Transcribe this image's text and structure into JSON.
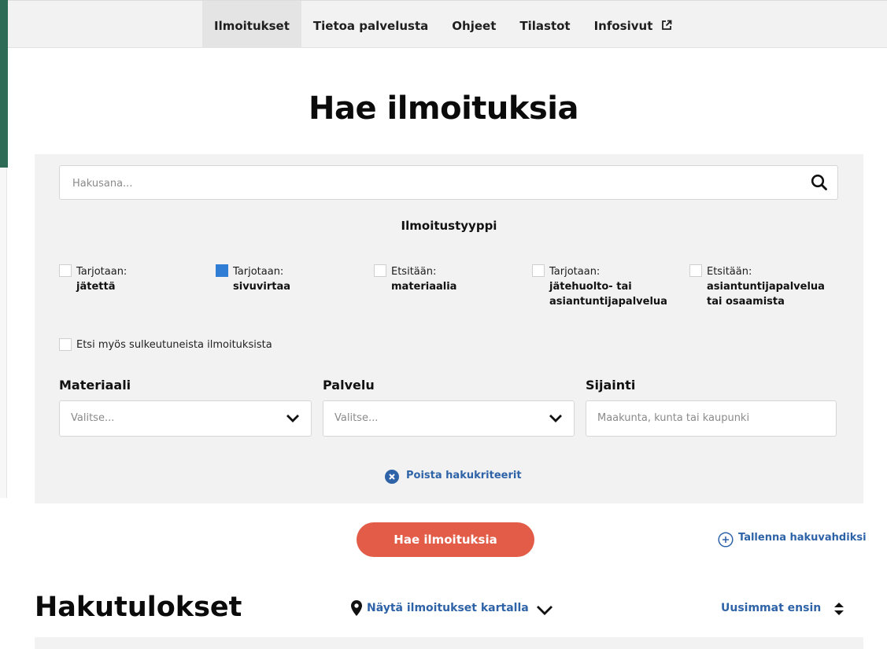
{
  "nav": {
    "items": [
      {
        "label": "Ilmoitukset",
        "active": true
      },
      {
        "label": "Tietoa palvelusta",
        "active": false
      },
      {
        "label": "Ohjeet",
        "active": false
      },
      {
        "label": "Tilastot",
        "active": false
      },
      {
        "label": "Infosivut",
        "active": false,
        "icon": "external-link-icon"
      }
    ]
  },
  "page": {
    "title": "Hae ilmoituksia"
  },
  "search": {
    "placeholder": "Hakusana...",
    "value": "",
    "icon": "search-icon"
  },
  "types": {
    "heading": "Ilmoitustyyppi",
    "options": [
      {
        "line1": "Tarjotaan:",
        "line2": "jätettä",
        "checked": false
      },
      {
        "line1": "Tarjotaan:",
        "line2": "sivuvirtaa",
        "checked": true
      },
      {
        "line1": "Etsitään:",
        "line2": "materiaalia",
        "checked": false
      },
      {
        "line1": "Tarjotaan:",
        "line2": "jätehuolto- tai asiantuntijapalvelua",
        "checked": false
      },
      {
        "line1": "Etsitään:",
        "line2": "asiantuntijapalvelua tai osaamista",
        "checked": false
      }
    ]
  },
  "closed": {
    "label": "Etsi myös sulkeutuneista ilmoituksista",
    "checked": false
  },
  "filters": {
    "material": {
      "label": "Materiaali",
      "placeholder": "Valitse..."
    },
    "service": {
      "label": "Palvelu",
      "placeholder": "Valitse..."
    },
    "location": {
      "label": "Sijainti",
      "placeholder": "Maakunta, kunta tai kaupunki"
    }
  },
  "clear_criteria": "Poista hakukriteerit",
  "search_button": "Hae ilmoituksia",
  "save_watch": "Tallenna hakuvahdiksi",
  "results": {
    "title": "Hakutulokset",
    "map_toggle": "Näytä ilmoitukset kartalla",
    "sort": "Uusimmat ensin"
  },
  "colors": {
    "accent_green": "#2e6b57",
    "primary_button": "#e25c48",
    "link_blue": "#2f63a8",
    "checkbox_blue": "#2f7dd4",
    "panel_bg": "#f2f2f2"
  }
}
